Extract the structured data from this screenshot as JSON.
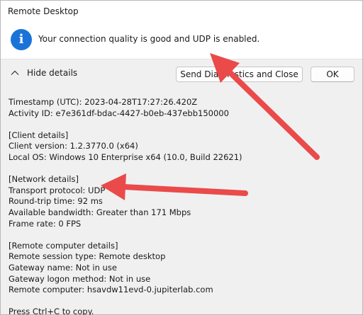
{
  "window": {
    "title": "Remote Desktop"
  },
  "message": {
    "icon": "info-icon",
    "text": "Your connection quality is good and UDP is enabled."
  },
  "controls": {
    "toggle_label": "Hide details",
    "send_label": "Send Diagnostics and Close",
    "ok_label": "OK"
  },
  "details": {
    "timestamp": "Timestamp (UTC): 2023-04-28T17:27:26.420Z",
    "activity_id": "Activity ID: e7e361df-bdac-4427-b0eb-437ebb150000",
    "client_header": "[Client details]",
    "client_version": "Client version: 1.2.3770.0 (x64)",
    "local_os": "Local OS: Windows 10 Enterprise x64 (10.0, Build 22621)",
    "network_header": "[Network details]",
    "transport": "Transport protocol: UDP",
    "rtt": "Round-trip time: 92 ms",
    "bandwidth": "Available bandwidth: Greater than 171 Mbps",
    "frame_rate": "Frame rate: 0 FPS",
    "remote_header": "[Remote computer details]",
    "session_type": "Remote session type: Remote desktop",
    "gateway_name": "Gateway name: Not in use",
    "gateway_logon": "Gateway logon method: Not in use",
    "remote_computer": "Remote computer: hsavdw11evd-0.jupiterlab.com",
    "copy_hint": "Press Ctrl+C to copy."
  },
  "colors": {
    "accent": "#1a73d9",
    "annotation_arrow": "#ea4a4a"
  }
}
